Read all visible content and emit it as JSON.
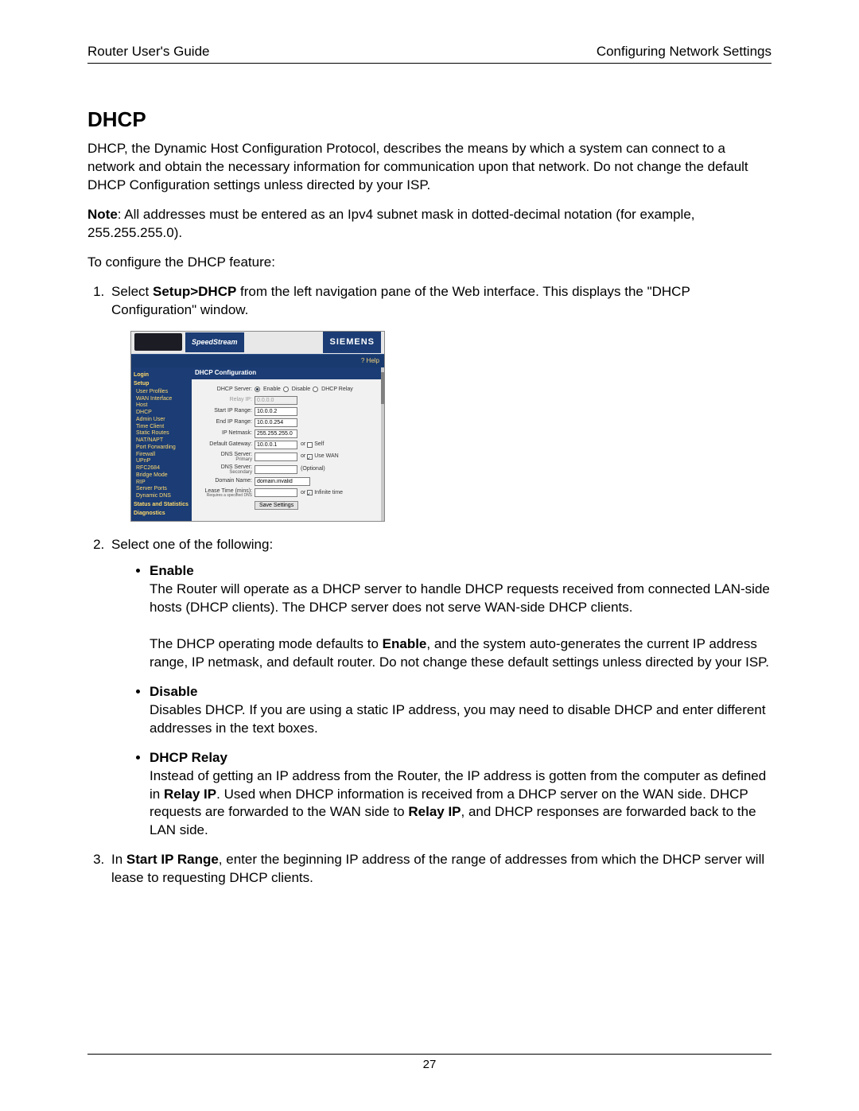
{
  "header": {
    "left": "Router User's Guide",
    "right": "Configuring Network Settings"
  },
  "title": "DHCP",
  "intro_para": "DHCP, the Dynamic Host Configuration Protocol, describes the means by which a system can connect to a network and obtain the necessary information for communication upon that network. Do not change the default DHCP Configuration settings unless directed by your ISP.",
  "note_label": "Note",
  "note_text": ": All addresses must be entered as an Ipv4 subnet mask in dotted-decimal notation (for example, 255.255.255.0).",
  "to_configure": "To configure the DHCP feature:",
  "step1_pre": "Select ",
  "step1_bold": "Setup>DHCP",
  "step1_post": " from the left navigation pane of the Web interface. This displays the \"DHCP Configuration\" window.",
  "step2": "Select one of the following:",
  "opt_enable_title": "Enable",
  "opt_enable_p1": "The Router will operate as a DHCP server to handle DHCP requests received from connected LAN-side hosts (DHCP clients). The DHCP server does not serve WAN-side DHCP clients.",
  "opt_enable_p2_a": "The DHCP operating mode defaults to ",
  "opt_enable_p2_bold": "Enable",
  "opt_enable_p2_b": ", and the system auto-generates the current IP address range, IP netmask, and default router. Do not change these default settings unless directed by your ISP.",
  "opt_disable_title": "Disable",
  "opt_disable_p": "Disables DHCP. If you are using a static IP address, you may need to disable DHCP and enter different addresses in the text boxes.",
  "opt_relay_title": "DHCP Relay",
  "opt_relay_a": "Instead of getting an IP address from the Router, the IP address is gotten from the computer as defined in ",
  "opt_relay_bold1": "Relay IP",
  "opt_relay_b": ". Used when DHCP information is received from a DHCP server on the WAN side. DHCP requests are forwarded to the WAN side to ",
  "opt_relay_bold2": "Relay IP",
  "opt_relay_c": ", and DHCP responses are forwarded back to the LAN side.",
  "step3_a": "In ",
  "step3_bold": "Start IP Range",
  "step3_b": ", enter the beginning IP address of the range of addresses from which the DHCP server will lease to requesting DHCP clients.",
  "page_number": "27",
  "screenshot": {
    "brand_left": "SpeedStream",
    "brand_right": "SIEMENS",
    "help": "? Help",
    "nav": {
      "login": "Login",
      "setup": "Setup",
      "items": [
        "User Profiles",
        "WAN Interface",
        "Host",
        "DHCP",
        "Admin User",
        "Time Client",
        "Static Routes",
        "NAT/NAPT",
        "Port Forwarding",
        "Firewall",
        "UPnP",
        "RFC2684",
        "Bridge Mode",
        "RIP",
        "Server Ports",
        "Dynamic DNS"
      ],
      "status": "Status and Statistics",
      "diag": "Diagnostics"
    },
    "panel_title": "DHCP Configuration",
    "form": {
      "dhcp_server_label": "DHCP Server:",
      "opt_enable": "Enable",
      "opt_disable": "Disable",
      "opt_relay": "DHCP Relay",
      "relay_ip_label": "Relay IP:",
      "relay_ip_value": "0.0.0.0",
      "start_ip_label": "Start IP Range:",
      "start_ip_value": "10.0.0.2",
      "end_ip_label": "End IP Range:",
      "end_ip_value": "10.0.0.254",
      "netmask_label": "IP Netmask:",
      "netmask_value": "255.255.255.0",
      "gw_label": "Default Gateway:",
      "gw_value": "10.0.0.1",
      "self": "Self",
      "dns1_label": "DNS Server:",
      "dns1_sub": "Primary",
      "usewan": "Use WAN",
      "dns2_label": "DNS Server:",
      "dns2_sub": "Secondary",
      "optional": "(Optional)",
      "domain_label": "Domain Name:",
      "domain_value": "domain.invalid",
      "lease_label": "Lease Time (mins):",
      "lease_note": "Requires a specified DNS",
      "infinite": "Infinite time",
      "or": "or",
      "save": "Save Settings"
    }
  }
}
